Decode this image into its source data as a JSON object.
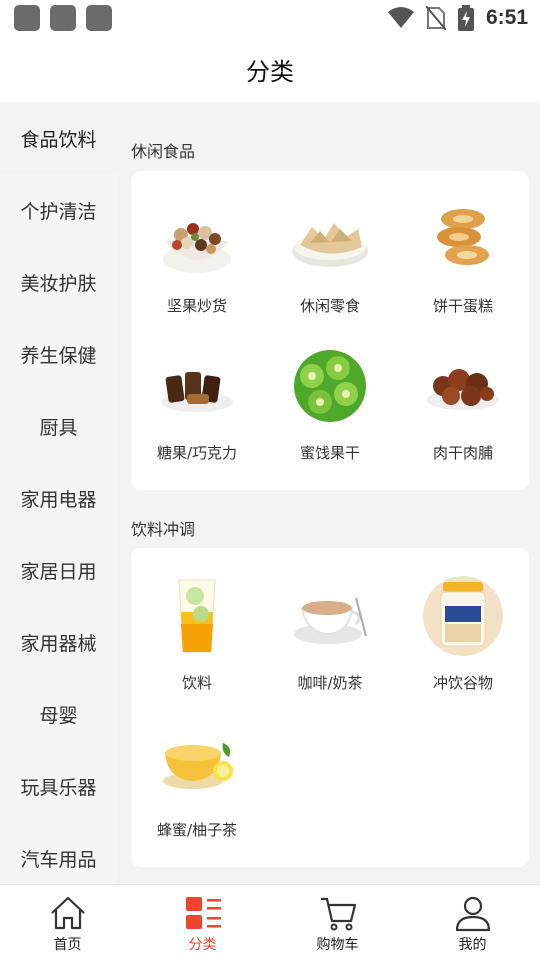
{
  "status_bar": {
    "time": "6:51"
  },
  "header": {
    "title": "分类"
  },
  "sidebar": {
    "items": [
      {
        "label": "食品饮料"
      },
      {
        "label": "个护清洁"
      },
      {
        "label": "美妆护肤"
      },
      {
        "label": "养生保健"
      },
      {
        "label": "厨具"
      },
      {
        "label": "家用电器"
      },
      {
        "label": "家居日用"
      },
      {
        "label": "家用器械"
      },
      {
        "label": "母婴"
      },
      {
        "label": "玩具乐器"
      },
      {
        "label": "汽车用品"
      }
    ],
    "active_index": 0
  },
  "sections": [
    {
      "title": "休闲食品",
      "items": [
        {
          "label": "坚果炒货",
          "icon": "nuts-icon"
        },
        {
          "label": "休闲零食",
          "icon": "snacks-icon"
        },
        {
          "label": "饼干蛋糕",
          "icon": "biscuits-icon"
        },
        {
          "label": "糖果/巧克力",
          "icon": "chocolate-icon"
        },
        {
          "label": "蜜饯果干",
          "icon": "dried-kiwi-icon"
        },
        {
          "label": "肉干肉脯",
          "icon": "jerky-icon"
        }
      ]
    },
    {
      "title": "饮料冲调",
      "items": [
        {
          "label": "饮料",
          "icon": "drink-icon"
        },
        {
          "label": "咖啡/奶茶",
          "icon": "coffee-icon"
        },
        {
          "label": "冲饮谷物",
          "icon": "cereal-jar-icon"
        },
        {
          "label": "蜂蜜/柚子茶",
          "icon": "honey-citron-icon"
        }
      ]
    }
  ],
  "bottom_nav": [
    {
      "label": "首页",
      "icon": "home-icon"
    },
    {
      "label": "分类",
      "icon": "category-icon"
    },
    {
      "label": "购物车",
      "icon": "cart-icon"
    },
    {
      "label": "我的",
      "icon": "user-icon"
    }
  ],
  "colors": {
    "accent": "#f0442c",
    "page_bg": "#f3f3f3",
    "card_bg": "#ffffff"
  }
}
